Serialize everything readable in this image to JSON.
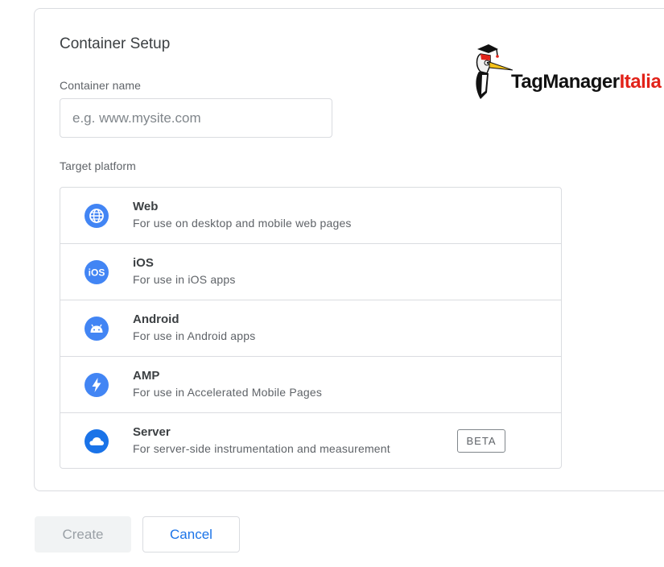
{
  "card": {
    "title": "Container Setup",
    "name_label": "Container name",
    "name_placeholder": "e.g. www.mysite.com",
    "name_value": "",
    "platform_label": "Target platform"
  },
  "platforms": [
    {
      "name": "Web",
      "description": "For use on desktop and mobile web pages",
      "icon": "globe-icon"
    },
    {
      "name": "iOS",
      "description": "For use in iOS apps",
      "icon": "ios-icon",
      "icon_text": "iOS"
    },
    {
      "name": "Android",
      "description": "For use in Android apps",
      "icon": "android-icon"
    },
    {
      "name": "AMP",
      "description": "For use in Accelerated Mobile Pages",
      "icon": "lightning-bolt-icon"
    },
    {
      "name": "Server",
      "description": "For server-side instrumentation and measurement",
      "icon": "cloud-icon",
      "badge": "BETA"
    }
  ],
  "logo": {
    "text_main": "TagManager",
    "text_accent": "Italia",
    "mascot_icon": "woodpecker-mascot-icon"
  },
  "buttons": {
    "create": "Create",
    "cancel": "Cancel"
  },
  "colors": {
    "icon_blue": "#4285f4",
    "link_blue": "#1a73e8",
    "logo_red": "#e2231a",
    "border": "#dadce0"
  }
}
